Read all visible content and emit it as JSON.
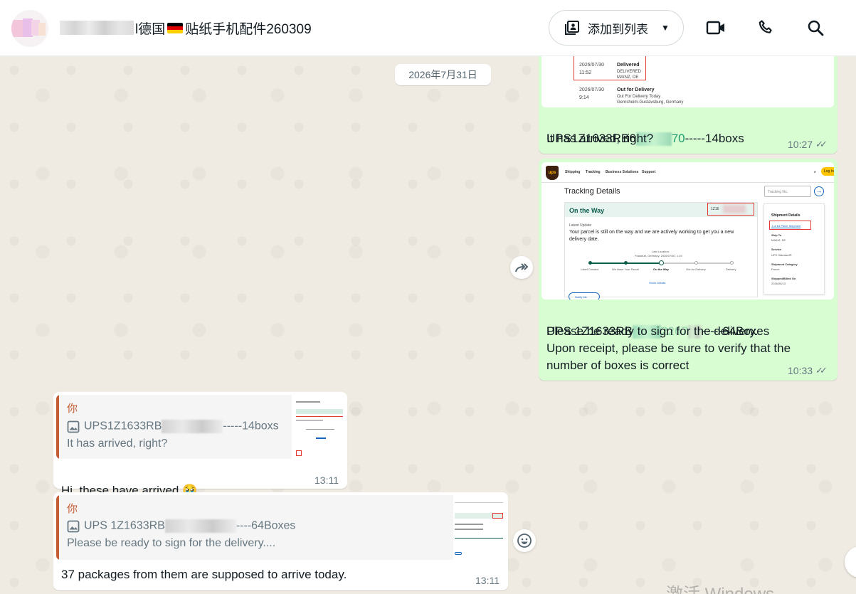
{
  "header": {
    "title_suffix": "l德国",
    "title_after_flag": "贴纸手机配件260309",
    "add_to_list_label": "添加到列表",
    "icons": [
      "video-call-icon",
      "voice-call-icon",
      "search-icon"
    ]
  },
  "chat": {
    "date_chip": "2026年7月31日",
    "messages": [
      {
        "direction": "out",
        "screenshot": {
          "row1_date": "2026/07/30",
          "row1_time": "11:52",
          "row1_status": "Delivered",
          "row1_detail_1": "DELIVERED",
          "row1_detail_2": "MAINZ, DE",
          "row2_date": "2026/07/30",
          "row2_time": "9:14",
          "row2_status": "Out for Delivery",
          "row2_detail_1": "Out For Delivery Today",
          "row2_detail_2": "Gernsheim-Gustavsburg, Germany"
        },
        "line1_prefix": "UPS1Z1633RB6",
        "line1_green": "70",
        "line1_suffix": "-----14boxs",
        "line2": "It has arrived, right?",
        "time": "10:27"
      },
      {
        "direction": "out",
        "screenshot": {
          "nav": [
            "Shipping",
            "Tracking",
            "Business Solutions",
            "Support"
          ],
          "login": "Log In",
          "logo": "ups",
          "heading": "Tracking Details",
          "tracking_placeholder": "Tracking No.",
          "status": "On the Way",
          "tracking_no_short": "1Z16",
          "latest_update": "Latest Update",
          "update_text": "Your parcel is still on the way and we are actively working to get you a new delivery date.",
          "last_location": "Last Location:",
          "last_location_detail": "Frankfurt, Germany, 2026/07/30, 1:19",
          "steps": [
            "Label Created",
            "We Have Your Parcel",
            "On the Way",
            "Out for Delivery",
            "Delivery"
          ],
          "show_details": "Show Details",
          "notify_me": "Notify Me",
          "side_title": "Shipment Details",
          "side_link": "1 of 64 Piece Shipment",
          "ship_to_label": "Ship To",
          "ship_to_value": "MAINZ, DE",
          "service_label": "Service",
          "service_value": "UPS Standard®",
          "category_label": "Shipment Category",
          "category_value": "Parcel",
          "shipped_label": "Shipped/Billed On",
          "shipped_value": "2026/06/13"
        },
        "line1_prefix": "UPS 1Z1633RB",
        "line1_green": "2267",
        "line1_suffix": "-----64Boxes",
        "line2": "Please be ready to sign for the delivery.",
        "line3": "Upon receipt, please be sure to verify that the",
        "line4": "number of boxes is correct",
        "time": "10:33"
      },
      {
        "direction": "in",
        "quote_author": "你",
        "quote_line1_prefix": "UPS1Z1633RB",
        "quote_line1_suffix": "-----14boxs",
        "quote_line2": "It has arrived, right?",
        "text": "Hi, these have arrived.",
        "emoji": "🥹",
        "time": "13:11"
      },
      {
        "direction": "in",
        "quote_author": "你",
        "quote_line1_prefix": "UPS 1Z1633RB",
        "quote_line1_suffix": "----64Boxes",
        "quote_line2": "Please be ready to sign for the delivery....",
        "text": "37 packages from them are supposed to arrive today.",
        "time": "13:11"
      }
    ]
  },
  "watermark": "激活 Windows",
  "colors": {
    "outgoing_bubble": "#d9fdd3",
    "incoming_bubble": "#ffffff",
    "chat_background": "#efeae2",
    "quote_accent": "#c35e34"
  }
}
